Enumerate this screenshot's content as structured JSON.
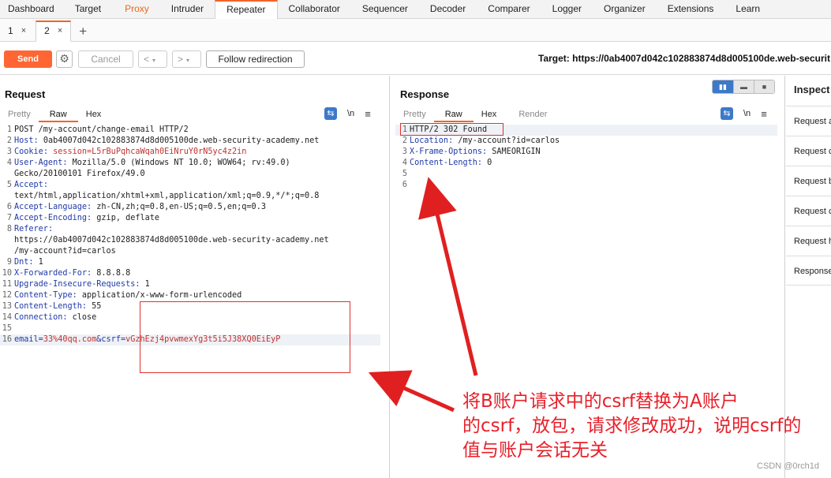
{
  "menubar": {
    "items": [
      "Dashboard",
      "Target",
      "Proxy",
      "Intruder",
      "Repeater",
      "Collaborator",
      "Sequencer",
      "Decoder",
      "Comparer",
      "Logger",
      "Organizer",
      "Extensions",
      "Learn"
    ]
  },
  "subtabs": {
    "tabs": [
      {
        "label": "1",
        "close": "×"
      },
      {
        "label": "2",
        "close": "×"
      }
    ],
    "add": "+"
  },
  "toolbar": {
    "send": "Send",
    "cancel": "Cancel",
    "back": "<",
    "forward": ">",
    "dropdown": "▾",
    "follow": "Follow redirection",
    "target": "Target: https://0ab4007d042c102883874d8d005100de.web-securit"
  },
  "request": {
    "title": "Request",
    "tabs": [
      "Pretty",
      "Raw",
      "Hex"
    ],
    "lines": [
      {
        "n": "1",
        "key": "",
        "val": "POST /my-account/change-email HTTP/2"
      },
      {
        "n": "2",
        "key": "Host",
        "val": " 0ab4007d042c102883874d8d005100de.web-security-academy.net"
      },
      {
        "n": "3",
        "key": "Cookie",
        "val": " session=L5rBuPqhcaWqah0EiNruY0rN5yc4z2in"
      },
      {
        "n": "4",
        "key": "User-Agent",
        "val": " Mozilla/5.0 (Windows NT 10.0; WOW64; rv:49.0)"
      },
      {
        "n": "",
        "key": "",
        "val": "Gecko/20100101 Firefox/49.0"
      },
      {
        "n": "5",
        "key": "Accept",
        "val": ""
      },
      {
        "n": "",
        "key": "",
        "val": "text/html,application/xhtml+xml,application/xml;q=0.9,*/*;q=0.8"
      },
      {
        "n": "6",
        "key": "Accept-Language",
        "val": " zh-CN,zh;q=0.8,en-US;q=0.5,en;q=0.3"
      },
      {
        "n": "7",
        "key": "Accept-Encoding",
        "val": " gzip, deflate"
      },
      {
        "n": "8",
        "key": "Referer",
        "val": ""
      },
      {
        "n": "",
        "key": "",
        "val": "https://0ab4007d042c102883874d8d005100de.web-security-academy.net"
      },
      {
        "n": "",
        "key": "",
        "val": "/my-account?id=carlos"
      },
      {
        "n": "9",
        "key": "Dnt",
        "val": " 1"
      },
      {
        "n": "10",
        "key": "X-Forwarded-For",
        "val": " 8.8.8.8"
      },
      {
        "n": "11",
        "key": "Upgrade-Insecure-Requests",
        "val": " 1"
      },
      {
        "n": "12",
        "key": "Content-Type",
        "val": " application/x-www-form-urlencoded"
      },
      {
        "n": "13",
        "key": "Content-Length",
        "val": " 55"
      },
      {
        "n": "14",
        "key": "Connection",
        "val": " close"
      },
      {
        "n": "15",
        "key": "",
        "val": ""
      }
    ],
    "body_line": {
      "n": "16",
      "email_key": "email",
      "email_val": "33%40qq.com",
      "amp": "&",
      "csrf_key": "csrf",
      "csrf_val": "vGzhEzj4pvwmexYg3t5i5J38XQ0EiEyP"
    }
  },
  "response": {
    "title": "Response",
    "tabs": [
      "Pretty",
      "Raw",
      "Hex",
      "Render"
    ],
    "lines": [
      {
        "n": "1",
        "key": "",
        "val": "HTTP/2 302 Found"
      },
      {
        "n": "2",
        "key": "Location",
        "val": " /my-account?id=carlos"
      },
      {
        "n": "3",
        "key": "X-Frame-Options",
        "val": " SAMEORIGIN"
      },
      {
        "n": "4",
        "key": "Content-Length",
        "val": " 0"
      },
      {
        "n": "5",
        "key": "",
        "val": ""
      },
      {
        "n": "6",
        "key": "",
        "val": ""
      }
    ]
  },
  "inspector": {
    "title": "Inspect",
    "items": [
      "Request a",
      "Request c",
      "Request b",
      "Request c",
      "Request h",
      "Response"
    ]
  },
  "icons": {
    "wrap": "⇆",
    "newline": "\\n",
    "menu": "≡",
    "gear": "⚙"
  },
  "annotation": {
    "lines": [
      "将B账户请求中的csrf替换为A账户",
      "的csrf，放包，请求修改成功，说明csrf的",
      "值与账户会话无关"
    ],
    "color": "#e8202a"
  },
  "watermark": "CSDN @0rch1d"
}
